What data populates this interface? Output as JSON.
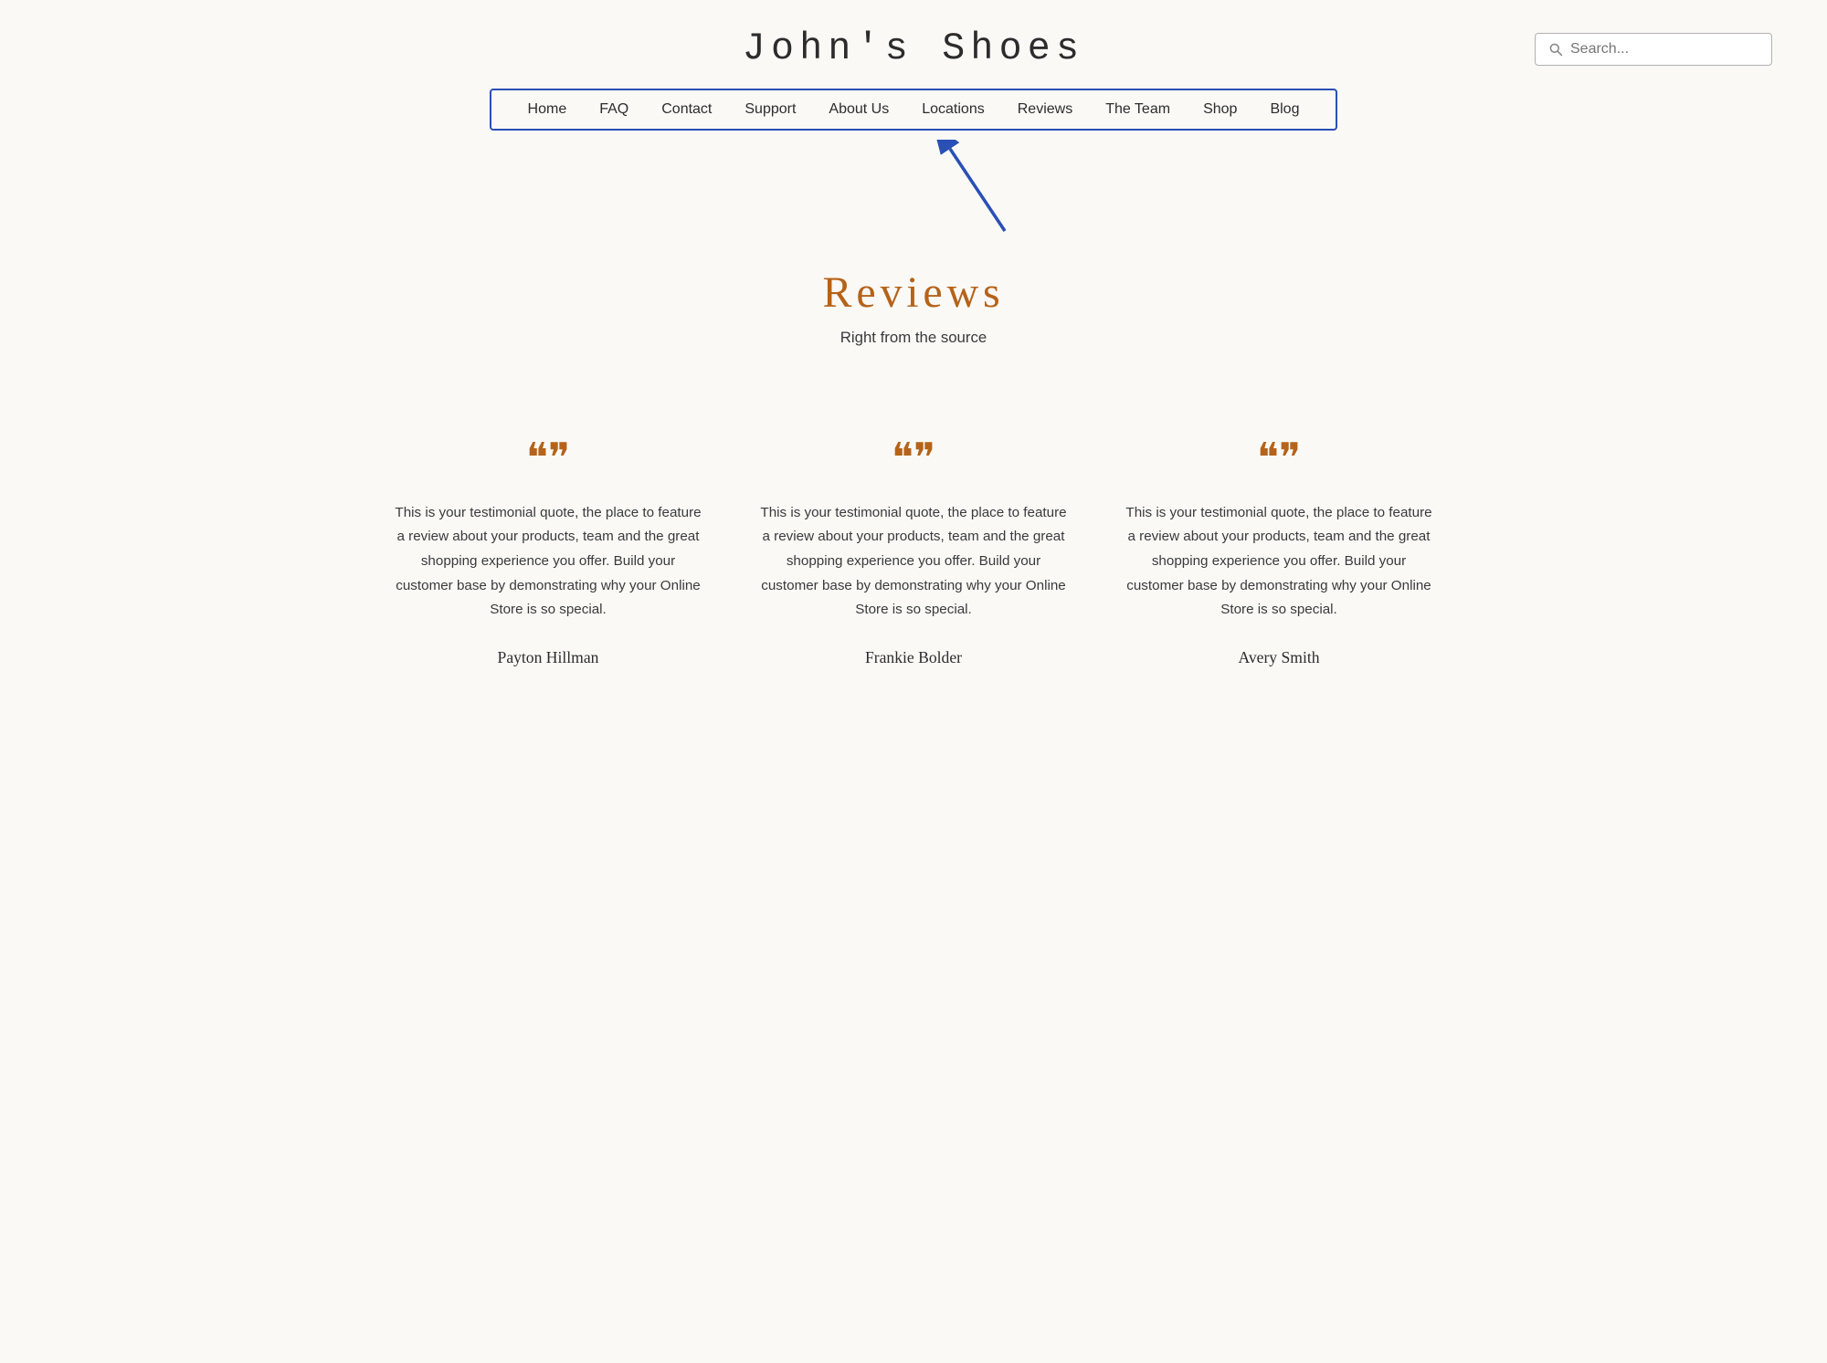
{
  "header": {
    "site_title": "John's Shoes",
    "search_placeholder": "Search..."
  },
  "nav": {
    "items": [
      {
        "label": "Home",
        "id": "home"
      },
      {
        "label": "FAQ",
        "id": "faq"
      },
      {
        "label": "Contact",
        "id": "contact"
      },
      {
        "label": "Support",
        "id": "support"
      },
      {
        "label": "About Us",
        "id": "about-us"
      },
      {
        "label": "Locations",
        "id": "locations"
      },
      {
        "label": "Reviews",
        "id": "reviews"
      },
      {
        "label": "The Team",
        "id": "the-team"
      },
      {
        "label": "Shop",
        "id": "shop"
      },
      {
        "label": "Blog",
        "id": "blog"
      }
    ]
  },
  "reviews_section": {
    "title": "Reviews",
    "subtitle": "Right from the source"
  },
  "testimonials": [
    {
      "quote_icon": "❝❞",
      "text": "This is your testimonial quote, the place to feature a review about your products, team and the great shopping experience you offer. Build your customer base by demonstrating why your Online Store is so special.",
      "author": "Payton Hillman"
    },
    {
      "quote_icon": "❝❞",
      "text": "This is your testimonial quote, the place to feature a review about your products, team and the great shopping experience you offer. Build your customer base by demonstrating why your Online Store is so special.",
      "author": "Frankie Bolder"
    },
    {
      "quote_icon": "❝❞",
      "text": "This is your testimonial quote, the place to feature a review about your products, team and the great shopping experience you offer. Build your customer base by demonstrating why your Online Store is so special.",
      "author": "Avery Smith"
    }
  ]
}
